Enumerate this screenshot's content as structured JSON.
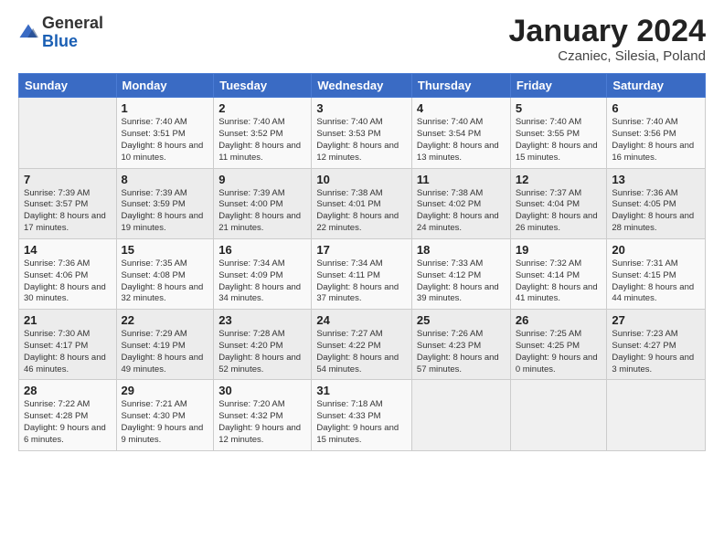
{
  "header": {
    "logo": {
      "general": "General",
      "blue": "Blue"
    },
    "title": "January 2024",
    "subtitle": "Czaniec, Silesia, Poland"
  },
  "weekdays": [
    "Sunday",
    "Monday",
    "Tuesday",
    "Wednesday",
    "Thursday",
    "Friday",
    "Saturday"
  ],
  "weeks": [
    [
      {
        "day": "",
        "sunrise": "",
        "sunset": "",
        "daylight": ""
      },
      {
        "day": "1",
        "sunrise": "Sunrise: 7:40 AM",
        "sunset": "Sunset: 3:51 PM",
        "daylight": "Daylight: 8 hours and 10 minutes."
      },
      {
        "day": "2",
        "sunrise": "Sunrise: 7:40 AM",
        "sunset": "Sunset: 3:52 PM",
        "daylight": "Daylight: 8 hours and 11 minutes."
      },
      {
        "day": "3",
        "sunrise": "Sunrise: 7:40 AM",
        "sunset": "Sunset: 3:53 PM",
        "daylight": "Daylight: 8 hours and 12 minutes."
      },
      {
        "day": "4",
        "sunrise": "Sunrise: 7:40 AM",
        "sunset": "Sunset: 3:54 PM",
        "daylight": "Daylight: 8 hours and 13 minutes."
      },
      {
        "day": "5",
        "sunrise": "Sunrise: 7:40 AM",
        "sunset": "Sunset: 3:55 PM",
        "daylight": "Daylight: 8 hours and 15 minutes."
      },
      {
        "day": "6",
        "sunrise": "Sunrise: 7:40 AM",
        "sunset": "Sunset: 3:56 PM",
        "daylight": "Daylight: 8 hours and 16 minutes."
      }
    ],
    [
      {
        "day": "7",
        "sunrise": "Sunrise: 7:39 AM",
        "sunset": "Sunset: 3:57 PM",
        "daylight": "Daylight: 8 hours and 17 minutes."
      },
      {
        "day": "8",
        "sunrise": "Sunrise: 7:39 AM",
        "sunset": "Sunset: 3:59 PM",
        "daylight": "Daylight: 8 hours and 19 minutes."
      },
      {
        "day": "9",
        "sunrise": "Sunrise: 7:39 AM",
        "sunset": "Sunset: 4:00 PM",
        "daylight": "Daylight: 8 hours and 21 minutes."
      },
      {
        "day": "10",
        "sunrise": "Sunrise: 7:38 AM",
        "sunset": "Sunset: 4:01 PM",
        "daylight": "Daylight: 8 hours and 22 minutes."
      },
      {
        "day": "11",
        "sunrise": "Sunrise: 7:38 AM",
        "sunset": "Sunset: 4:02 PM",
        "daylight": "Daylight: 8 hours and 24 minutes."
      },
      {
        "day": "12",
        "sunrise": "Sunrise: 7:37 AM",
        "sunset": "Sunset: 4:04 PM",
        "daylight": "Daylight: 8 hours and 26 minutes."
      },
      {
        "day": "13",
        "sunrise": "Sunrise: 7:36 AM",
        "sunset": "Sunset: 4:05 PM",
        "daylight": "Daylight: 8 hours and 28 minutes."
      }
    ],
    [
      {
        "day": "14",
        "sunrise": "Sunrise: 7:36 AM",
        "sunset": "Sunset: 4:06 PM",
        "daylight": "Daylight: 8 hours and 30 minutes."
      },
      {
        "day": "15",
        "sunrise": "Sunrise: 7:35 AM",
        "sunset": "Sunset: 4:08 PM",
        "daylight": "Daylight: 8 hours and 32 minutes."
      },
      {
        "day": "16",
        "sunrise": "Sunrise: 7:34 AM",
        "sunset": "Sunset: 4:09 PM",
        "daylight": "Daylight: 8 hours and 34 minutes."
      },
      {
        "day": "17",
        "sunrise": "Sunrise: 7:34 AM",
        "sunset": "Sunset: 4:11 PM",
        "daylight": "Daylight: 8 hours and 37 minutes."
      },
      {
        "day": "18",
        "sunrise": "Sunrise: 7:33 AM",
        "sunset": "Sunset: 4:12 PM",
        "daylight": "Daylight: 8 hours and 39 minutes."
      },
      {
        "day": "19",
        "sunrise": "Sunrise: 7:32 AM",
        "sunset": "Sunset: 4:14 PM",
        "daylight": "Daylight: 8 hours and 41 minutes."
      },
      {
        "day": "20",
        "sunrise": "Sunrise: 7:31 AM",
        "sunset": "Sunset: 4:15 PM",
        "daylight": "Daylight: 8 hours and 44 minutes."
      }
    ],
    [
      {
        "day": "21",
        "sunrise": "Sunrise: 7:30 AM",
        "sunset": "Sunset: 4:17 PM",
        "daylight": "Daylight: 8 hours and 46 minutes."
      },
      {
        "day": "22",
        "sunrise": "Sunrise: 7:29 AM",
        "sunset": "Sunset: 4:19 PM",
        "daylight": "Daylight: 8 hours and 49 minutes."
      },
      {
        "day": "23",
        "sunrise": "Sunrise: 7:28 AM",
        "sunset": "Sunset: 4:20 PM",
        "daylight": "Daylight: 8 hours and 52 minutes."
      },
      {
        "day": "24",
        "sunrise": "Sunrise: 7:27 AM",
        "sunset": "Sunset: 4:22 PM",
        "daylight": "Daylight: 8 hours and 54 minutes."
      },
      {
        "day": "25",
        "sunrise": "Sunrise: 7:26 AM",
        "sunset": "Sunset: 4:23 PM",
        "daylight": "Daylight: 8 hours and 57 minutes."
      },
      {
        "day": "26",
        "sunrise": "Sunrise: 7:25 AM",
        "sunset": "Sunset: 4:25 PM",
        "daylight": "Daylight: 9 hours and 0 minutes."
      },
      {
        "day": "27",
        "sunrise": "Sunrise: 7:23 AM",
        "sunset": "Sunset: 4:27 PM",
        "daylight": "Daylight: 9 hours and 3 minutes."
      }
    ],
    [
      {
        "day": "28",
        "sunrise": "Sunrise: 7:22 AM",
        "sunset": "Sunset: 4:28 PM",
        "daylight": "Daylight: 9 hours and 6 minutes."
      },
      {
        "day": "29",
        "sunrise": "Sunrise: 7:21 AM",
        "sunset": "Sunset: 4:30 PM",
        "daylight": "Daylight: 9 hours and 9 minutes."
      },
      {
        "day": "30",
        "sunrise": "Sunrise: 7:20 AM",
        "sunset": "Sunset: 4:32 PM",
        "daylight": "Daylight: 9 hours and 12 minutes."
      },
      {
        "day": "31",
        "sunrise": "Sunrise: 7:18 AM",
        "sunset": "Sunset: 4:33 PM",
        "daylight": "Daylight: 9 hours and 15 minutes."
      },
      {
        "day": "",
        "sunrise": "",
        "sunset": "",
        "daylight": ""
      },
      {
        "day": "",
        "sunrise": "",
        "sunset": "",
        "daylight": ""
      },
      {
        "day": "",
        "sunrise": "",
        "sunset": "",
        "daylight": ""
      }
    ]
  ]
}
